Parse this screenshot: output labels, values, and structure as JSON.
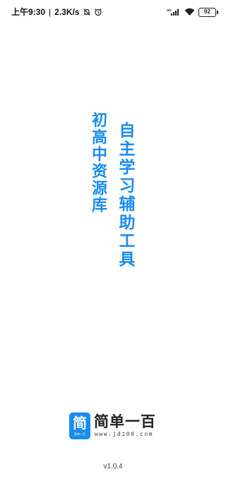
{
  "status_bar": {
    "time": "上午9:30",
    "network_speed": "2.3K/s",
    "icons_left": [
      "mute-bell-icon",
      "alarm-icon"
    ],
    "icons_right": [
      "hd-signal-icon",
      "wifi-icon",
      "battery-icon"
    ],
    "hd_label": "HD",
    "battery_level": "92"
  },
  "slogans": {
    "left": "初高中资源库",
    "right": "自主学习辅助工具"
  },
  "logo": {
    "icon_char": "简",
    "icon_subtext": "简单一百",
    "title": "简单一百",
    "url": "www.jd100.com"
  },
  "version": "v1.0.4",
  "colors": {
    "accent": "#1a8cf0",
    "background": "#ffffff",
    "text": "#222222"
  }
}
